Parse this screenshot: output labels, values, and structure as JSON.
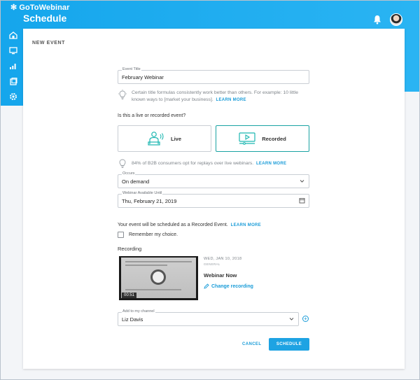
{
  "app": {
    "logo_text": "GoToWebinar",
    "page_title": "Schedule"
  },
  "card": {
    "heading": "NEW EVENT"
  },
  "event_title": {
    "label": "Event Title",
    "value": "February Webinar"
  },
  "title_tip": {
    "text": "Certain title formulas consistently work better than others. For example: 10 little known ways to [market your business].",
    "link": "LEARN MORE"
  },
  "event_type": {
    "question": "Is this a live or recorded event?",
    "options": [
      {
        "label": "Live",
        "icon": "live-presenter-icon",
        "selected": false
      },
      {
        "label": "Recorded",
        "icon": "recorded-video-icon",
        "selected": true
      }
    ]
  },
  "type_tip": {
    "text": "84% of B2B consumers opt for replays over live webinars.",
    "link": "LEARN MORE"
  },
  "occurs": {
    "label": "Occurs",
    "value": "On demand"
  },
  "available_until": {
    "label": "Webinar Available Until",
    "value": "Thu, February 21, 2019"
  },
  "schedule_note": {
    "prefix": "Your event will be scheduled as a ",
    "emphasis": "Recorded Event.",
    "link": "LEARN MORE"
  },
  "remember": {
    "label": "Remember my choice.",
    "checked": false
  },
  "recording": {
    "heading": "Recording",
    "duration": "00:51",
    "date": "WED, JAN 10, 2018",
    "category": "GENERAL",
    "name": "Webinar Now",
    "change_label": "Change recording"
  },
  "channel": {
    "label": "Add to my channel",
    "value": "Liz Davis"
  },
  "actions": {
    "cancel": "CANCEL",
    "schedule": "SCHEDULE"
  },
  "colors": {
    "brand_blue": "#1ea3e3",
    "teal_selected": "#1aa3a3",
    "link_blue": "#1a9cd8"
  }
}
